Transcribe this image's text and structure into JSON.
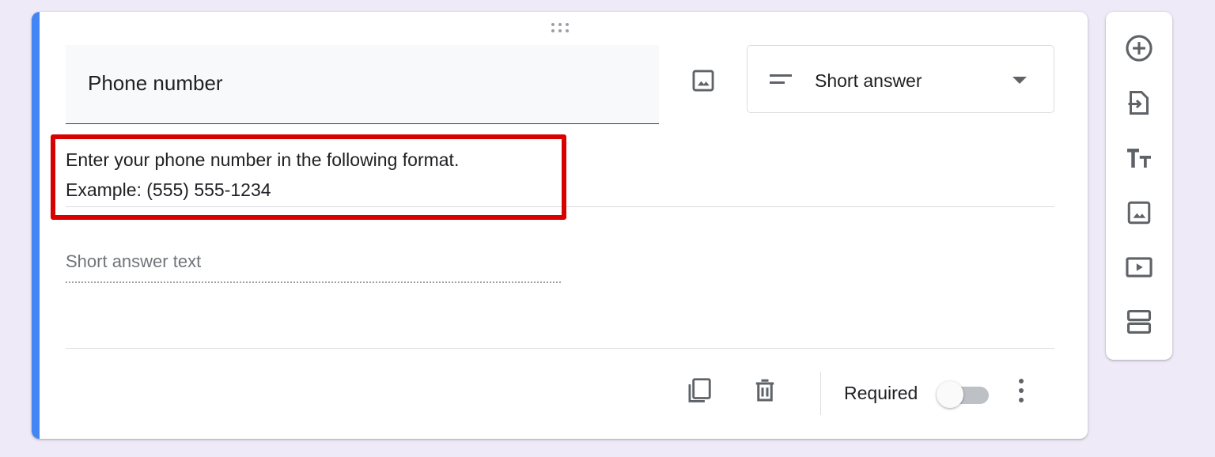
{
  "question": {
    "title": "Phone number",
    "type_label": "Short answer",
    "description_lines": [
      "Enter your phone number in the following format.",
      "Example: (555) 555-1234"
    ],
    "answer_placeholder": "Short answer text",
    "required_label": "Required",
    "required": false
  },
  "side_toolbar": {
    "items": [
      "add-question-icon",
      "import-questions-icon",
      "add-title-icon",
      "add-image-icon",
      "add-video-icon",
      "add-section-icon"
    ]
  },
  "colors": {
    "accent": "#4285f4",
    "highlight": "#d90000",
    "background": "#efeaf7"
  }
}
